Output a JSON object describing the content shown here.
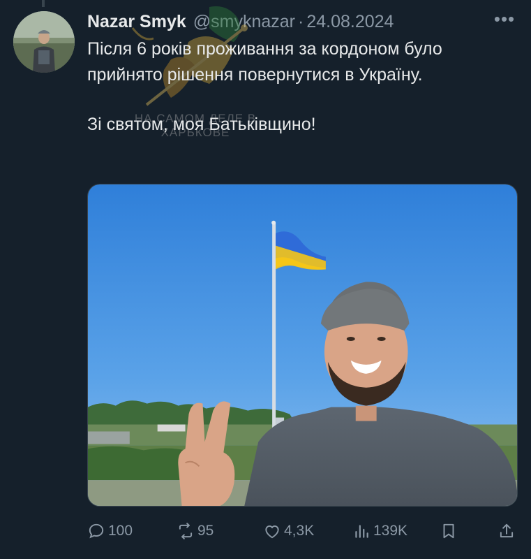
{
  "author": {
    "name": "Nazar Smyk",
    "handle": "@smyknazar",
    "separator": "·",
    "date": "24.08.2024"
  },
  "more_label": "•••",
  "text": {
    "paragraph1": "Після 6 років проживання за кордоном було прийнято рішення повернутися в Україну.",
    "paragraph2": "Зі святом, моя Батьківщино!"
  },
  "watermark": {
    "line1": "НА САМОМ ДЕЛЕ В",
    "line2": "ХАРЬКОВЕ"
  },
  "media": {
    "icon": "photo-selfie-with-flag",
    "sky_color": "#3f8de0",
    "flag_colors": [
      "#2f6bd8",
      "#f5c518"
    ]
  },
  "actions": {
    "replies": "100",
    "reposts": "95",
    "likes": "4,3K",
    "views": "139K",
    "bookmark_icon": "bookmark-icon",
    "share_icon": "share-icon"
  },
  "colors": {
    "background": "#15202b",
    "text": "#e7e9ea",
    "secondary": "#8b98a5"
  }
}
